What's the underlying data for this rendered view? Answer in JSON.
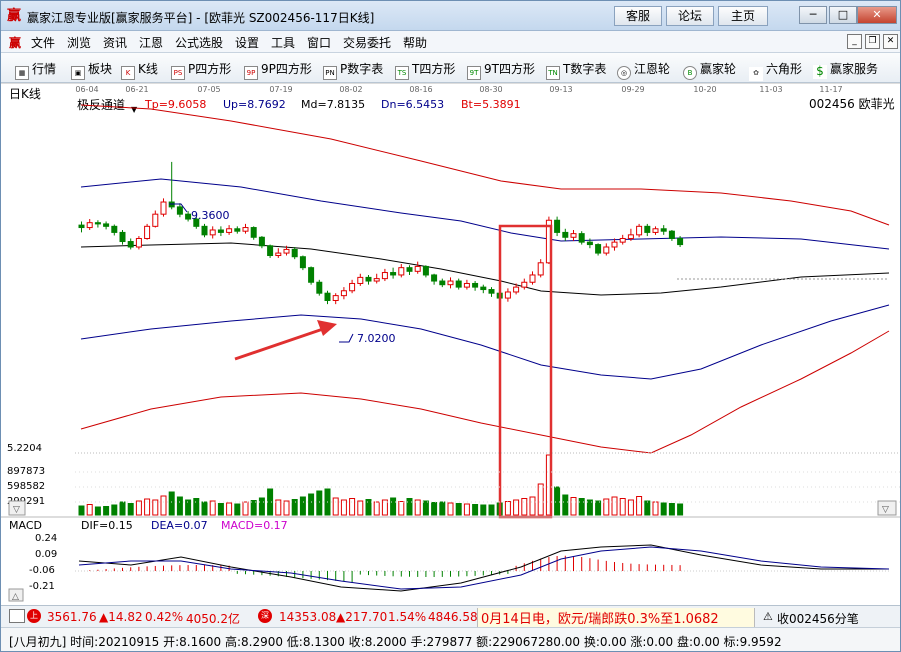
{
  "window": {
    "logo": "赢",
    "title": "赢家江恩专业版[赢家服务平台] - [欧菲光  SZ002456-117日K线]",
    "btn_service": "客服",
    "btn_forum": "论坛",
    "btn_home": "主页"
  },
  "menu": {
    "logo": "赢",
    "items": [
      "文件",
      "浏览",
      "资讯",
      "江恩",
      "公式选股",
      "设置",
      "工具",
      "窗口",
      "交易委托",
      "帮助"
    ]
  },
  "toolbar": {
    "items": [
      {
        "icon": "▦",
        "label": "行情"
      },
      {
        "icon": "▣",
        "label": "板块"
      },
      {
        "icon": "K",
        "label": "K线"
      },
      {
        "icon": "PS",
        "label": "P四方形"
      },
      {
        "icon": "9P",
        "label": "9P四方形"
      },
      {
        "icon": "PN",
        "label": "P数字表"
      },
      {
        "icon": "TS",
        "label": "T四方形"
      },
      {
        "icon": "9T",
        "label": "9T四方形"
      },
      {
        "icon": "TN",
        "label": "T数字表"
      },
      {
        "icon": "◎",
        "label": "江恩轮"
      },
      {
        "icon": "B",
        "label": "赢家轮"
      },
      {
        "icon": "✿",
        "label": "六角形"
      },
      {
        "icon": "$",
        "label": "赢家服务"
      }
    ]
  },
  "chart": {
    "period": "日K线",
    "date_ticks": [
      "06-04",
      "06-21",
      "07-05",
      "07-19",
      "08-02",
      "08-16",
      "08-30",
      "09-13",
      "09-29",
      "10-20",
      "11-03",
      "11-17"
    ],
    "indicator": "极反通道",
    "tp": "Tp=9.6058",
    "up": "Up=8.7692",
    "md": "Md=7.8135",
    "dn": "Dn=6.5453",
    "bt": "Bt=5.3891",
    "stock": "002456 欧菲光",
    "high_label": "9.3600",
    "low_label": "7.0200",
    "vol_axis": [
      "5.2204",
      "897873",
      "598582",
      "299291"
    ],
    "macd_name": "MACD",
    "dif": "DIF=0.15",
    "dea": "DEA=0.07",
    "macd": "MACD=0.17",
    "macd_axis": [
      "0.24",
      "0.09",
      "-0.06",
      "-0.21"
    ],
    "colors": {
      "up": "#e00000",
      "down": "#008000",
      "upper_band": "#cc0000",
      "mid_band": "#00008b",
      "md_line": "#000000",
      "box": "#e03030"
    }
  },
  "chart_data": {
    "type": "candlestick",
    "title": "欧菲光 SZ002456 日K线",
    "candles": [
      {
        "o": 8.32,
        "c": 8.28,
        "h": 8.38,
        "l": 8.2
      },
      {
        "o": 8.28,
        "c": 8.36,
        "h": 8.42,
        "l": 8.24
      },
      {
        "o": 8.36,
        "c": 8.34,
        "h": 8.4,
        "l": 8.28
      },
      {
        "o": 8.34,
        "c": 8.3,
        "h": 8.38,
        "l": 8.25
      },
      {
        "o": 8.3,
        "c": 8.2,
        "h": 8.33,
        "l": 8.15
      },
      {
        "o": 8.2,
        "c": 8.05,
        "h": 8.24,
        "l": 8.0
      },
      {
        "o": 8.05,
        "c": 7.96,
        "h": 8.1,
        "l": 7.92
      },
      {
        "o": 7.96,
        "c": 8.1,
        "h": 8.14,
        "l": 7.92
      },
      {
        "o": 8.1,
        "c": 8.3,
        "h": 8.34,
        "l": 8.08
      },
      {
        "o": 8.3,
        "c": 8.5,
        "h": 8.56,
        "l": 8.28
      },
      {
        "o": 8.5,
        "c": 8.7,
        "h": 8.76,
        "l": 8.46
      },
      {
        "o": 8.7,
        "c": 8.62,
        "h": 9.36,
        "l": 8.58
      },
      {
        "o": 8.62,
        "c": 8.5,
        "h": 8.68,
        "l": 8.45
      },
      {
        "o": 8.5,
        "c": 8.42,
        "h": 8.55,
        "l": 8.38
      },
      {
        "o": 8.42,
        "c": 8.3,
        "h": 8.46,
        "l": 8.26
      },
      {
        "o": 8.3,
        "c": 8.16,
        "h": 8.34,
        "l": 8.12
      },
      {
        "o": 8.16,
        "c": 8.24,
        "h": 8.3,
        "l": 8.1
      },
      {
        "o": 8.24,
        "c": 8.2,
        "h": 8.3,
        "l": 8.14
      },
      {
        "o": 8.2,
        "c": 8.26,
        "h": 8.32,
        "l": 8.16
      },
      {
        "o": 8.26,
        "c": 8.22,
        "h": 8.3,
        "l": 8.18
      },
      {
        "o": 8.22,
        "c": 8.28,
        "h": 8.34,
        "l": 8.18
      },
      {
        "o": 8.28,
        "c": 8.12,
        "h": 8.3,
        "l": 8.08
      },
      {
        "o": 8.12,
        "c": 7.98,
        "h": 8.14,
        "l": 7.94
      },
      {
        "o": 7.98,
        "c": 7.82,
        "h": 8.0,
        "l": 7.78
      },
      {
        "o": 7.82,
        "c": 7.86,
        "h": 7.94,
        "l": 7.78
      },
      {
        "o": 7.86,
        "c": 7.92,
        "h": 7.98,
        "l": 7.82
      },
      {
        "o": 7.92,
        "c": 7.8,
        "h": 7.96,
        "l": 7.76
      },
      {
        "o": 7.8,
        "c": 7.62,
        "h": 7.82,
        "l": 7.58
      },
      {
        "o": 7.62,
        "c": 7.38,
        "h": 7.64,
        "l": 7.34
      },
      {
        "o": 7.38,
        "c": 7.2,
        "h": 7.42,
        "l": 7.16
      },
      {
        "o": 7.2,
        "c": 7.08,
        "h": 7.24,
        "l": 7.02
      },
      {
        "o": 7.08,
        "c": 7.16,
        "h": 7.2,
        "l": 7.02
      },
      {
        "o": 7.16,
        "c": 7.24,
        "h": 7.3,
        "l": 7.1
      },
      {
        "o": 7.24,
        "c": 7.36,
        "h": 7.42,
        "l": 7.2
      },
      {
        "o": 7.36,
        "c": 7.46,
        "h": 7.52,
        "l": 7.32
      },
      {
        "o": 7.46,
        "c": 7.4,
        "h": 7.5,
        "l": 7.34
      },
      {
        "o": 7.4,
        "c": 7.44,
        "h": 7.52,
        "l": 7.36
      },
      {
        "o": 7.44,
        "c": 7.54,
        "h": 7.6,
        "l": 7.4
      },
      {
        "o": 7.54,
        "c": 7.5,
        "h": 7.62,
        "l": 7.44
      },
      {
        "o": 7.5,
        "c": 7.62,
        "h": 7.68,
        "l": 7.46
      },
      {
        "o": 7.62,
        "c": 7.56,
        "h": 7.66,
        "l": 7.5
      },
      {
        "o": 7.56,
        "c": 7.64,
        "h": 7.72,
        "l": 7.52
      },
      {
        "o": 7.64,
        "c": 7.5,
        "h": 7.66,
        "l": 7.46
      },
      {
        "o": 7.5,
        "c": 7.4,
        "h": 7.52,
        "l": 7.34
      },
      {
        "o": 7.4,
        "c": 7.34,
        "h": 7.44,
        "l": 7.3
      },
      {
        "o": 7.34,
        "c": 7.4,
        "h": 7.46,
        "l": 7.28
      },
      {
        "o": 7.4,
        "c": 7.3,
        "h": 7.44,
        "l": 7.26
      },
      {
        "o": 7.3,
        "c": 7.36,
        "h": 7.42,
        "l": 7.26
      },
      {
        "o": 7.36,
        "c": 7.3,
        "h": 7.4,
        "l": 7.24
      },
      {
        "o": 7.3,
        "c": 7.26,
        "h": 7.34,
        "l": 7.2
      },
      {
        "o": 7.26,
        "c": 7.2,
        "h": 7.3,
        "l": 7.14
      },
      {
        "o": 7.2,
        "c": 7.12,
        "h": 7.24,
        "l": 7.08
      },
      {
        "o": 7.12,
        "c": 7.22,
        "h": 7.28,
        "l": 7.06
      },
      {
        "o": 7.22,
        "c": 7.3,
        "h": 7.36,
        "l": 7.18
      },
      {
        "o": 7.3,
        "c": 7.38,
        "h": 7.44,
        "l": 7.26
      },
      {
        "o": 7.38,
        "c": 7.5,
        "h": 7.56,
        "l": 7.34
      },
      {
        "o": 7.5,
        "c": 7.7,
        "h": 7.76,
        "l": 7.46
      },
      {
        "o": 7.7,
        "c": 8.4,
        "h": 8.46,
        "l": 7.68
      },
      {
        "o": 8.4,
        "c": 8.2,
        "h": 8.46,
        "l": 8.14
      },
      {
        "o": 8.2,
        "c": 8.12,
        "h": 8.26,
        "l": 8.06
      },
      {
        "o": 8.12,
        "c": 8.18,
        "h": 8.24,
        "l": 8.06
      },
      {
        "o": 8.18,
        "c": 8.04,
        "h": 8.22,
        "l": 8.0
      },
      {
        "o": 8.04,
        "c": 8.0,
        "h": 8.1,
        "l": 7.94
      },
      {
        "o": 8.0,
        "c": 7.86,
        "h": 8.02,
        "l": 7.82
      },
      {
        "o": 7.86,
        "c": 7.96,
        "h": 8.02,
        "l": 7.82
      },
      {
        "o": 7.96,
        "c": 8.04,
        "h": 8.1,
        "l": 7.9
      },
      {
        "o": 8.04,
        "c": 8.1,
        "h": 8.16,
        "l": 8.0
      },
      {
        "o": 8.1,
        "c": 8.16,
        "h": 8.26,
        "l": 8.06
      },
      {
        "o": 8.16,
        "c": 8.3,
        "h": 8.34,
        "l": 8.12
      },
      {
        "o": 8.3,
        "c": 8.2,
        "h": 8.34,
        "l": 8.14
      },
      {
        "o": 8.2,
        "c": 8.26,
        "h": 8.3,
        "l": 8.16
      },
      {
        "o": 8.26,
        "c": 8.22,
        "h": 8.32,
        "l": 8.16
      },
      {
        "o": 8.22,
        "c": 8.1,
        "h": 8.24,
        "l": 8.06
      },
      {
        "o": 8.1,
        "c": 8.0,
        "h": 8.14,
        "l": 7.96
      }
    ],
    "volumes": [
      180,
      210,
      160,
      170,
      200,
      260,
      230,
      280,
      320,
      300,
      380,
      460,
      360,
      300,
      330,
      260,
      280,
      230,
      240,
      220,
      260,
      290,
      340,
      520,
      300,
      280,
      310,
      360,
      420,
      480,
      520,
      340,
      300,
      330,
      280,
      310,
      260,
      300,
      340,
      270,
      330,
      300,
      280,
      250,
      260,
      240,
      230,
      220,
      210,
      200,
      200,
      240,
      270,
      300,
      330,
      360,
      620,
      1200,
      560,
      400,
      350,
      330,
      300,
      280,
      320,
      360,
      330,
      300,
      370,
      280,
      260,
      240,
      230,
      220
    ],
    "ylim_price": [
      4.9,
      10.0
    ],
    "vol_ylim": [
      0,
      1200
    ]
  },
  "status": {
    "sh": "3561.76",
    "sh_chg": "▲14.82",
    "sh_pct": "0.42%",
    "sh_amt": "4050.2亿",
    "sz": "14353.08",
    "sz_chg": "▲217.70",
    "sz_pct": "1.54%",
    "sz_amt": "4846.58",
    "news": "0月14日电，欧元/瑞郎跌0.3%至1.0682",
    "recv": "收002456分笔"
  },
  "info": {
    "text": "[八月初九] 时间:20210915 开:8.1600 高:8.2900 低:8.1300 收:8.2000 手:279877 额:229067280.00 换:0.00 涨:0.00 盘:0.00 标:9.9592"
  }
}
